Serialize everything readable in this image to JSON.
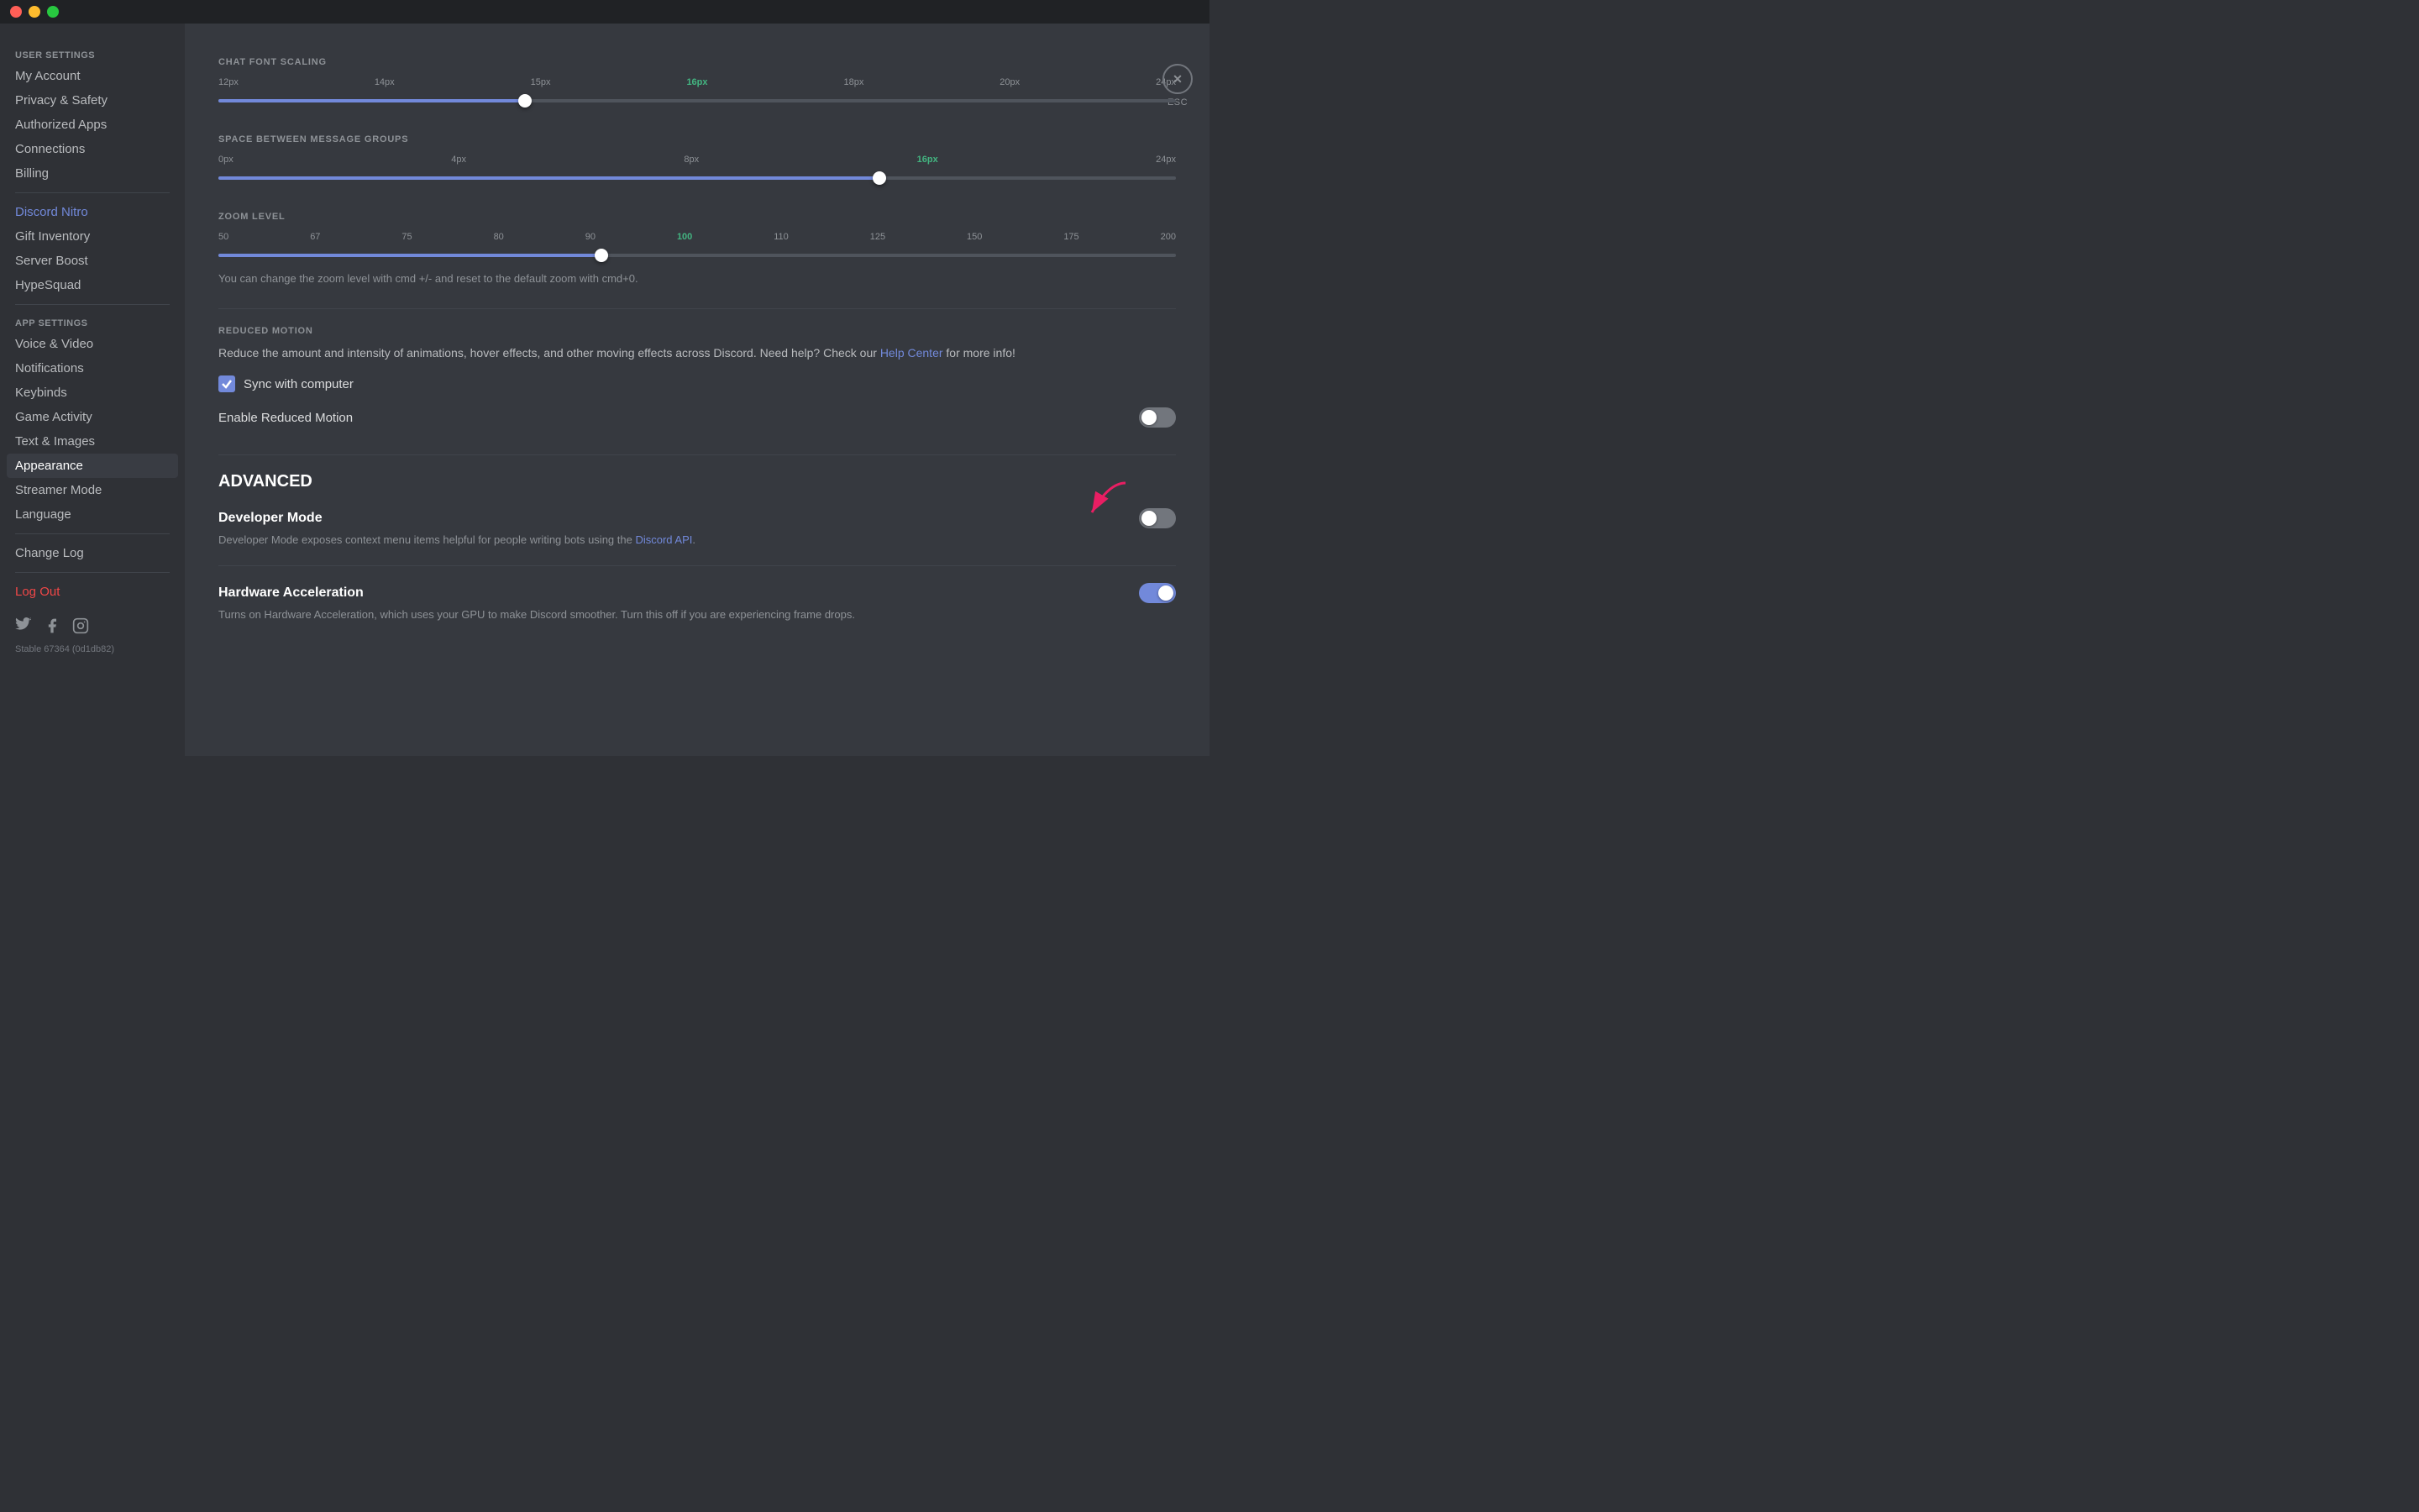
{
  "titlebar": {
    "close": "close",
    "minimize": "minimize",
    "maximize": "maximize"
  },
  "sidebar": {
    "user_settings_label": "User Settings",
    "app_settings_label": "App Settings",
    "items": {
      "my_account": "My Account",
      "privacy_safety": "Privacy & Safety",
      "authorized_apps": "Authorized Apps",
      "connections": "Connections",
      "billing": "Billing",
      "discord_nitro": "Discord Nitro",
      "gift_inventory": "Gift Inventory",
      "server_boost": "Server Boost",
      "hypesquad": "HypeSquad",
      "voice_video": "Voice & Video",
      "notifications": "Notifications",
      "keybinds": "Keybinds",
      "game_activity": "Game Activity",
      "text_images": "Text & Images",
      "appearance": "Appearance",
      "streamer_mode": "Streamer Mode",
      "language": "Language",
      "change_log": "Change Log",
      "log_out": "Log Out"
    }
  },
  "content": {
    "chat_font_scaling": {
      "title": "CHAT FONT SCALING",
      "labels": [
        "12px",
        "14px",
        "15px",
        "16px",
        "18px",
        "20px",
        "24px"
      ],
      "active_value": "16px",
      "fill_percent": 32
    },
    "space_between": {
      "title": "SPACE BETWEEN MESSAGE GROUPS",
      "labels": [
        "0px",
        "4px",
        "8px",
        "16px",
        "24px"
      ],
      "active_value": "16px",
      "fill_percent": 69
    },
    "zoom_level": {
      "title": "ZOOM LEVEL",
      "labels": [
        "50",
        "67",
        "75",
        "80",
        "90",
        "100",
        "110",
        "125",
        "150",
        "175",
        "200"
      ],
      "active_value": "100",
      "fill_percent": 40,
      "hint": "You can change the zoom level with cmd +/- and reset to the default zoom with cmd+0."
    },
    "reduced_motion": {
      "title": "REDUCED MOTION",
      "description": "Reduce the amount and intensity of animations, hover effects, and other moving effects across Discord. Need help? Check our ",
      "link_text": "Help Center",
      "description_end": " for more info!",
      "sync_label": "Sync with computer",
      "enable_label": "Enable Reduced Motion",
      "enable_on": false
    },
    "advanced": {
      "title": "ADVANCED",
      "developer_mode": {
        "name": "Developer Mode",
        "description": "Developer Mode exposes context menu items helpful for people writing bots using the ",
        "link_text": "Discord API",
        "description_end": ".",
        "on": false
      },
      "hardware_acceleration": {
        "name": "Hardware Acceleration",
        "description": "Turns on Hardware Acceleration, which uses your GPU to make Discord smoother. Turn this off if you are experiencing frame drops.",
        "on": true
      }
    }
  },
  "social": {
    "version": "Stable 67364 (0d1db82)"
  }
}
